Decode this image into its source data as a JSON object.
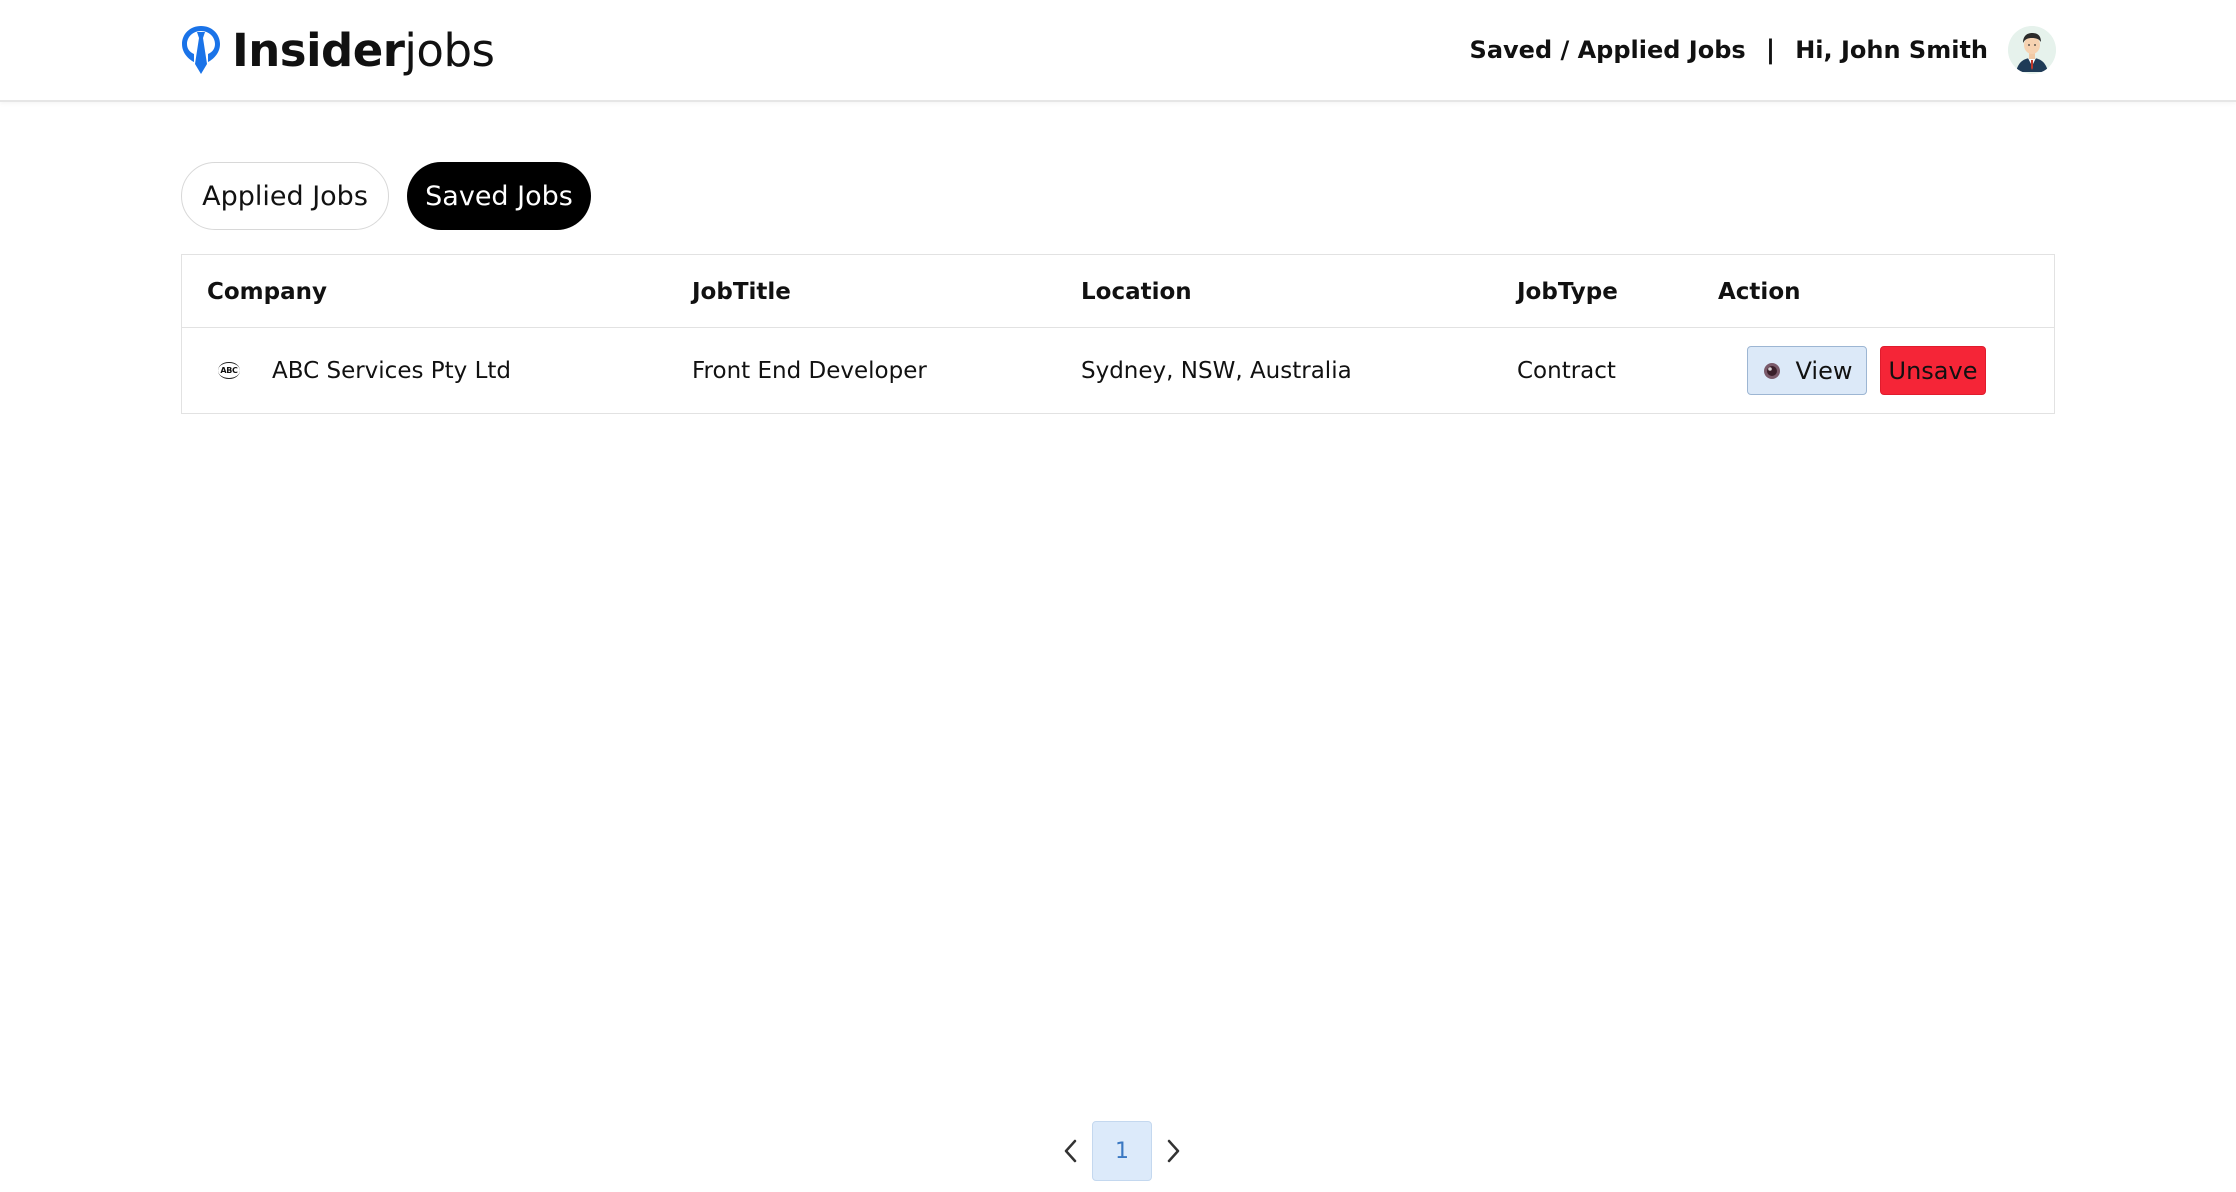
{
  "header": {
    "logo_strong": "Insider",
    "logo_light": "jobs",
    "nav_link": "Saved / Applied Jobs",
    "separator": "|",
    "greeting": "Hi, John Smith",
    "brand_color": "#1a73e8"
  },
  "tabs": [
    {
      "label": "Applied Jobs",
      "active": false
    },
    {
      "label": "Saved Jobs",
      "active": true
    }
  ],
  "table": {
    "columns": [
      "Company",
      "JobTitle",
      "Location",
      "JobType",
      "Action"
    ],
    "rows": [
      {
        "company_logo_text": "ABC",
        "company": "ABC Services Pty Ltd",
        "job_title": "Front End Developer",
        "location": "Sydney, NSW, Australia",
        "job_type": "Contract",
        "view_label": "View",
        "unsave_label": "Unsave"
      }
    ]
  },
  "pagination": {
    "current_page": "1"
  },
  "colors": {
    "active_tab_bg": "#000000",
    "view_button_bg": "#dce9f8",
    "unsave_button_bg": "#f52537",
    "page_button_bg": "#dceafa"
  }
}
